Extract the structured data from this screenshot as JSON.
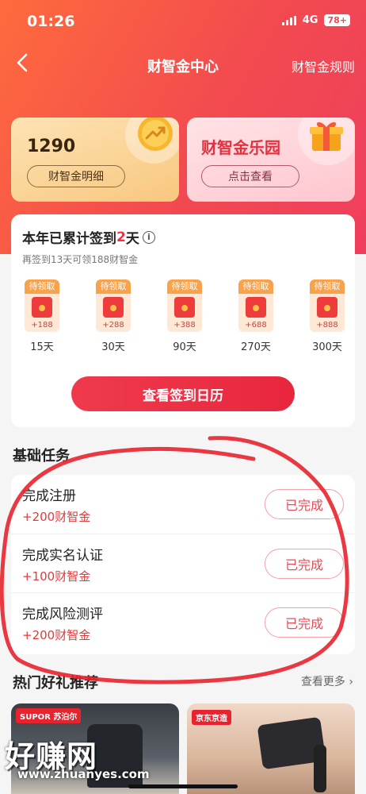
{
  "status_bar": {
    "time": "01:26",
    "network": "4G",
    "battery": "78+"
  },
  "nav": {
    "title": "财智金中心",
    "rules_link": "财智金规则"
  },
  "coin_card": {
    "value": "1290",
    "detail_button": "财智金明细"
  },
  "park_card": {
    "title": "财智金乐园",
    "view_button": "点击查看"
  },
  "signin": {
    "title_prefix": "本年已累计签到",
    "days": "2",
    "title_suffix": "天",
    "info_symbol": "i",
    "subtitle": "再签到13天可领188财智金",
    "rewards": [
      {
        "tag": "待领取",
        "amount": "+188",
        "day": "15天"
      },
      {
        "tag": "待领取",
        "amount": "+288",
        "day": "30天"
      },
      {
        "tag": "待领取",
        "amount": "+388",
        "day": "90天"
      },
      {
        "tag": "待领取",
        "amount": "+688",
        "day": "270天"
      },
      {
        "tag": "待领取",
        "amount": "+888",
        "day": "300天"
      }
    ],
    "calendar_button": "查看签到日历"
  },
  "basic_tasks": {
    "title": "基础任务",
    "items": [
      {
        "name": "完成注册",
        "reward": "+200财智金",
        "status": "已完成"
      },
      {
        "name": "完成实名认证",
        "reward": "+100财智金",
        "status": "已完成"
      },
      {
        "name": "完成风险测评",
        "reward": "+200财智金",
        "status": "已完成"
      }
    ]
  },
  "hot_gifts": {
    "title": "热门好礼推荐",
    "more": "查看更多",
    "products": [
      {
        "brand": "SUPOR 苏泊尔"
      },
      {
        "brand": "京东京造"
      }
    ]
  },
  "watermark": {
    "text": "好赚网",
    "url": "www.zhuanyes.com"
  },
  "colors": {
    "accent": "#ef3344",
    "hero_start": "#ff6b3d",
    "hero_end": "#ef3e5e",
    "annotation": "#e8232e"
  }
}
